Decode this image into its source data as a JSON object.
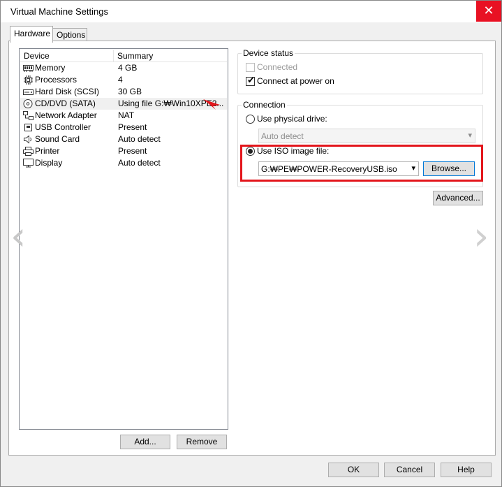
{
  "window": {
    "title": "Virtual Machine Settings",
    "close_icon": "✕"
  },
  "tabs": [
    {
      "label": "Hardware",
      "active": true
    },
    {
      "label": "Options",
      "active": false
    }
  ],
  "device_list": {
    "headers": {
      "device": "Device",
      "summary": "Summary"
    },
    "rows": [
      {
        "name": "Memory",
        "summary": "4 GB",
        "icon": "memory-icon"
      },
      {
        "name": "Processors",
        "summary": "4",
        "icon": "processor-icon"
      },
      {
        "name": "Hard Disk (SCSI)",
        "summary": "30 GB",
        "icon": "hard-disk-icon"
      },
      {
        "name": "CD/DVD (SATA)",
        "summary": "Using file G:₩Win10XPE2...",
        "icon": "cd-dvd-icon",
        "selected": true
      },
      {
        "name": "Network Adapter",
        "summary": "NAT",
        "icon": "network-adapter-icon"
      },
      {
        "name": "USB Controller",
        "summary": "Present",
        "icon": "usb-icon"
      },
      {
        "name": "Sound Card",
        "summary": "Auto detect",
        "icon": "speaker-icon"
      },
      {
        "name": "Printer",
        "summary": "Present",
        "icon": "printer-icon"
      },
      {
        "name": "Display",
        "summary": "Auto detect",
        "icon": "display-icon"
      }
    ]
  },
  "left_buttons": {
    "add": "Add...",
    "remove": "Remove"
  },
  "device_status": {
    "title": "Device status",
    "connected": {
      "label": "Connected",
      "checked": false,
      "enabled": false
    },
    "connect_at_power_on": {
      "label": "Connect at power on",
      "checked": true
    }
  },
  "connection": {
    "title": "Connection",
    "physical_drive": {
      "label": "Use physical drive:",
      "selected": false
    },
    "physical_drive_select": {
      "value": "Auto detect"
    },
    "iso_image": {
      "label": "Use ISO image file:",
      "selected": true
    },
    "iso_path": {
      "value": "G:₩PE₩POWER-RecoveryUSB.iso"
    },
    "browse_label": "Browse..."
  },
  "advanced_label": "Advanced...",
  "footer": {
    "ok": "OK",
    "cancel": "Cancel",
    "help": "Help"
  },
  "colors": {
    "highlight": "#e3161c",
    "accent": "#0078d7",
    "close": "#e81123"
  }
}
